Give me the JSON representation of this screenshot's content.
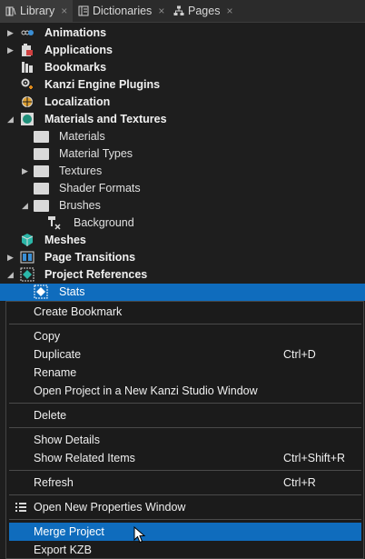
{
  "tabs": [
    {
      "label": "Library",
      "icon": "library-icon",
      "close": "×"
    },
    {
      "label": "Dictionaries",
      "icon": "dictionary-icon",
      "close": "×"
    },
    {
      "label": "Pages",
      "icon": "pages-icon",
      "close": "×"
    }
  ],
  "tree": {
    "items": [
      {
        "label": "Animations"
      },
      {
        "label": "Applications"
      },
      {
        "label": "Bookmarks"
      },
      {
        "label": "Kanzi Engine Plugins"
      },
      {
        "label": "Localization"
      },
      {
        "label": "Materials and Textures"
      },
      {
        "label": "Materials"
      },
      {
        "label": "Material Types"
      },
      {
        "label": "Textures"
      },
      {
        "label": "Shader Formats"
      },
      {
        "label": "Brushes"
      },
      {
        "label": "Background"
      },
      {
        "label": "Meshes"
      },
      {
        "label": "Page Transitions"
      },
      {
        "label": "Project References"
      },
      {
        "label": "Stats"
      }
    ]
  },
  "context_menu": {
    "items": [
      {
        "label": "Create Bookmark",
        "shortcut": ""
      },
      {
        "label": "Copy",
        "shortcut": ""
      },
      {
        "label": "Duplicate",
        "shortcut": "Ctrl+D"
      },
      {
        "label": "Rename",
        "shortcut": ""
      },
      {
        "label": "Open Project in a New Kanzi Studio Window",
        "shortcut": ""
      },
      {
        "label": "Delete",
        "shortcut": ""
      },
      {
        "label": "Show Details",
        "shortcut": ""
      },
      {
        "label": "Show Related Items",
        "shortcut": "Ctrl+Shift+R"
      },
      {
        "label": "Refresh",
        "shortcut": "Ctrl+R"
      },
      {
        "label": "Open New Properties Window",
        "shortcut": ""
      },
      {
        "label": "Merge Project",
        "shortcut": ""
      },
      {
        "label": "Export KZB",
        "shortcut": ""
      }
    ]
  },
  "colors": {
    "selection": "#0f6cbd",
    "background": "#1e1e1e",
    "text": "#e6e6e6"
  }
}
